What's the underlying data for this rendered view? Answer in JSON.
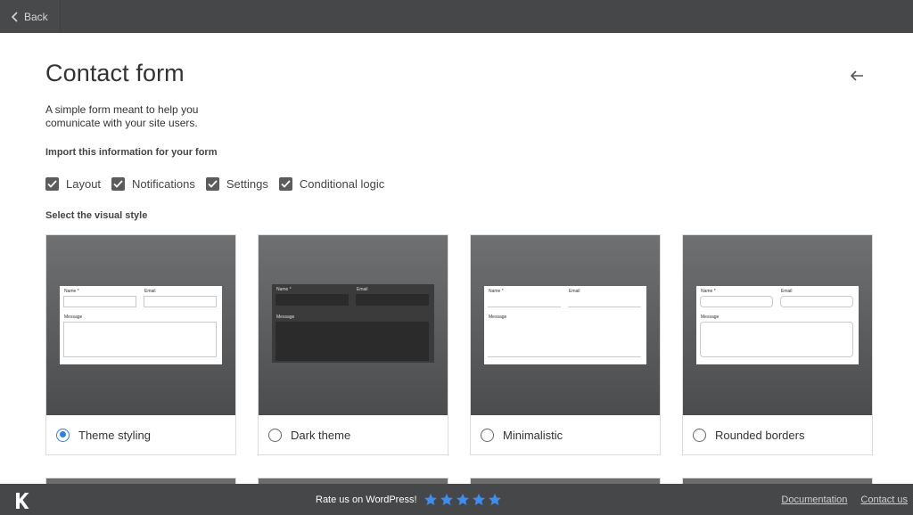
{
  "topbar": {
    "back_label": "Back"
  },
  "form": {
    "title": "Contact form",
    "description": "A simple form meant to help you comunicate with your site users.",
    "import_label": "Import this information for your form",
    "import_options": [
      {
        "label": "Layout",
        "checked": true
      },
      {
        "label": "Notifications",
        "checked": true
      },
      {
        "label": "Settings",
        "checked": true
      },
      {
        "label": "Conditional logic",
        "checked": true
      }
    ],
    "style_label": "Select the visual style",
    "preview_fields": {
      "name": "Name *",
      "email": "Email",
      "message": "Message"
    },
    "styles": [
      {
        "label": "Theme styling",
        "selected": true
      },
      {
        "label": "Dark theme",
        "selected": false
      },
      {
        "label": "Minimalistic",
        "selected": false
      },
      {
        "label": "Rounded borders",
        "selected": false
      }
    ]
  },
  "footer": {
    "rate_label": "Rate us on WordPress!",
    "stars": 5,
    "star_color": "#3d8ef0",
    "links": {
      "documentation": "Documentation",
      "contact": "Contact us"
    }
  }
}
